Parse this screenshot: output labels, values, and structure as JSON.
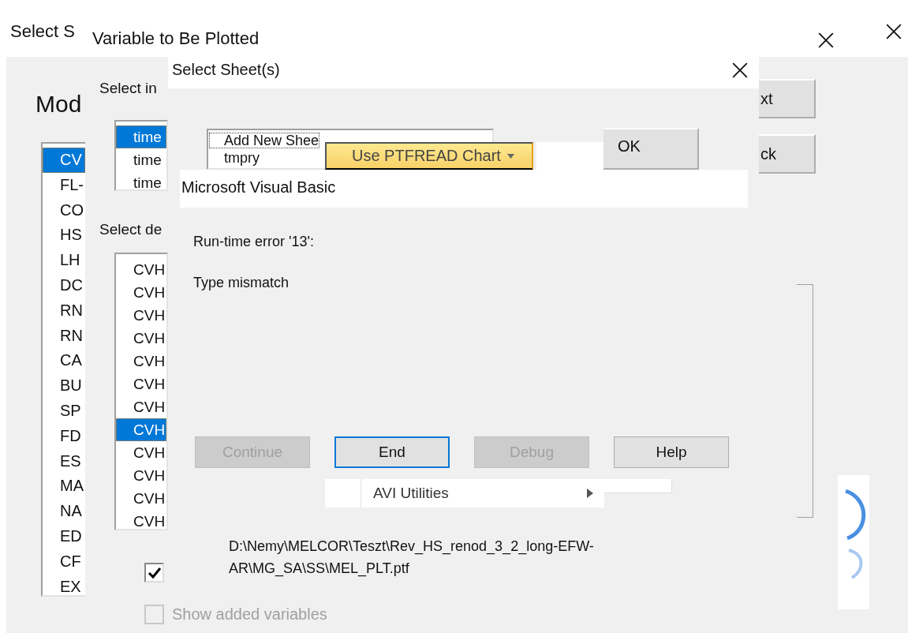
{
  "back_window": {
    "title": "Select S",
    "heading": "Mod",
    "list": [
      {
        "label": "CV",
        "selected": true
      },
      {
        "label": "FL-",
        "selected": false
      },
      {
        "label": "CO",
        "selected": false
      },
      {
        "label": "HS",
        "selected": false
      },
      {
        "label": "LH",
        "selected": false
      },
      {
        "label": "DC",
        "selected": false
      },
      {
        "label": "RN",
        "selected": false
      },
      {
        "label": "RN",
        "selected": false
      },
      {
        "label": "CA",
        "selected": false
      },
      {
        "label": "BU",
        "selected": false
      },
      {
        "label": "SP",
        "selected": false
      },
      {
        "label": "FD",
        "selected": false
      },
      {
        "label": "ES",
        "selected": false
      },
      {
        "label": "MA",
        "selected": false
      },
      {
        "label": "NA",
        "selected": false
      },
      {
        "label": "ED",
        "selected": false
      },
      {
        "label": "CF",
        "selected": false
      },
      {
        "label": "EX",
        "selected": false
      }
    ],
    "buttons": [
      "xt",
      "ck"
    ]
  },
  "variable_window": {
    "title": "Variable to Be Plotted",
    "independent_label": "Select in",
    "independent_list": [
      {
        "label": "time",
        "selected": true
      },
      {
        "label": "time",
        "selected": false
      },
      {
        "label": "time",
        "selected": false
      }
    ],
    "dependent_label": "Select de",
    "dependent_list": [
      {
        "label": "CVH",
        "selected": false
      },
      {
        "label": "CVH",
        "selected": false
      },
      {
        "label": "CVH",
        "selected": false
      },
      {
        "label": "CVH",
        "selected": false
      },
      {
        "label": "CVH",
        "selected": false
      },
      {
        "label": "CVH",
        "selected": false
      },
      {
        "label": "CVH",
        "selected": false
      },
      {
        "label": "CVH",
        "selected": true
      },
      {
        "label": "CVH",
        "selected": false
      },
      {
        "label": "CVH",
        "selected": false
      },
      {
        "label": "CVH",
        "selected": false
      },
      {
        "label": "CVH",
        "selected": false
      }
    ],
    "checkboxes": [
      {
        "checked": true,
        "disabled": false
      },
      {
        "label": "Show added variables",
        "checked": false,
        "disabled": true
      }
    ]
  },
  "sheet_window": {
    "title": "Select Sheet(s)",
    "sheets": [
      {
        "label": "Add New Shee",
        "selected": false
      },
      {
        "label": "tmpry",
        "selected": false
      }
    ],
    "ok_button": "OK"
  },
  "ribbon_button": {
    "label": "Use PTFREAD Chart"
  },
  "error_dialog": {
    "title": "Microsoft Visual Basic",
    "message": "Run-time error '13':",
    "detail": "Type mismatch",
    "buttons": [
      {
        "label": "Continue",
        "disabled": true,
        "focused": false
      },
      {
        "label": "End",
        "disabled": false,
        "focused": true
      },
      {
        "label": "Debug",
        "disabled": true,
        "focused": false
      },
      {
        "label": "Help",
        "disabled": false,
        "focused": false
      }
    ]
  },
  "menu_item": {
    "label": "AVI Utilities"
  },
  "file_path": "D:\\Nemy\\MELCOR\\Teszt\\Rev_HS_renod_3_2_long-EFW-AR\\MG_SA\\SS\\MEL_PLT.ptf"
}
